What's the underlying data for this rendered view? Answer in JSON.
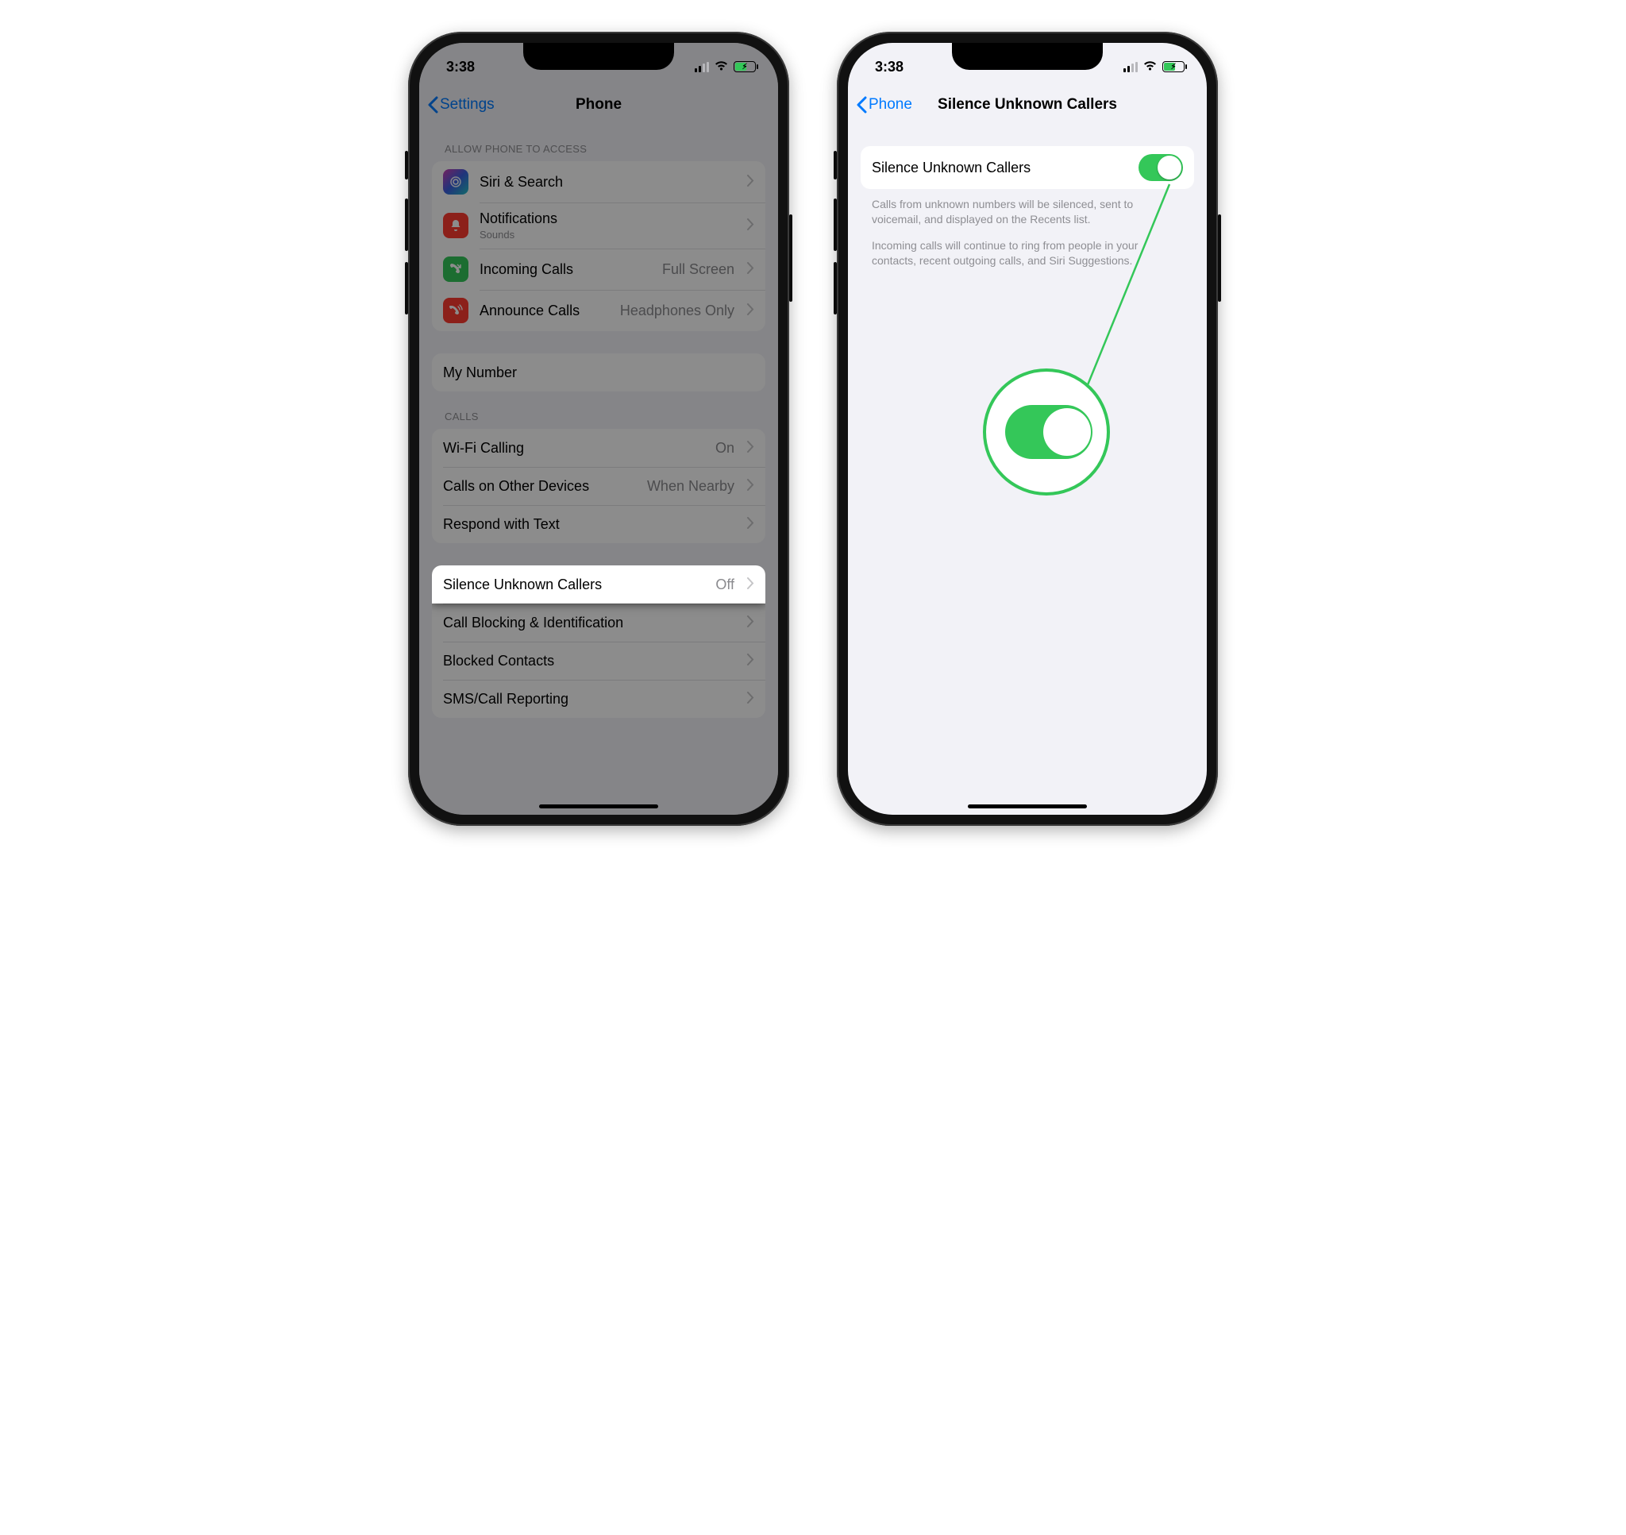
{
  "status": {
    "time": "3:38"
  },
  "left": {
    "nav": {
      "back": "Settings",
      "title": "Phone"
    },
    "section_access_header": "ALLOW PHONE TO ACCESS",
    "items_access": [
      {
        "label": "Siri & Search"
      },
      {
        "label": "Notifications",
        "sub": "Sounds"
      },
      {
        "label": "Incoming Calls",
        "value": "Full Screen"
      },
      {
        "label": "Announce Calls",
        "value": "Headphones Only"
      }
    ],
    "my_number": "My Number",
    "section_calls_header": "CALLS",
    "items_calls": [
      {
        "label": "Wi-Fi Calling",
        "value": "On"
      },
      {
        "label": "Calls on Other Devices",
        "value": "When Nearby"
      },
      {
        "label": "Respond with Text"
      }
    ],
    "items_block": [
      {
        "label": "Silence Unknown Callers",
        "value": "Off"
      },
      {
        "label": "Call Blocking & Identification"
      },
      {
        "label": "Blocked Contacts"
      },
      {
        "label": "SMS/Call Reporting"
      }
    ]
  },
  "right": {
    "nav": {
      "back": "Phone",
      "title": "Silence Unknown Callers"
    },
    "toggle_label": "Silence Unknown Callers",
    "footer1": "Calls from unknown numbers will be silenced, sent to voicemail, and displayed on the Recents list.",
    "footer2": "Incoming calls will continue to ring from people in your contacts, recent outgoing calls, and Siri Suggestions."
  }
}
